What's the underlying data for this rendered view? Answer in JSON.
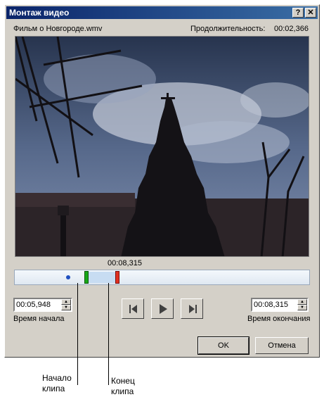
{
  "window": {
    "title": "Монтаж видео",
    "help_label": "?",
    "close_label": "✕"
  },
  "file_name": "Фильм о Новгороде.wmv",
  "duration": {
    "label": "Продолжительность:",
    "value": "00:02,366"
  },
  "timeline": {
    "marker_time": "00:08,315"
  },
  "start": {
    "value": "00:05,948",
    "label": "Время начала"
  },
  "end": {
    "value": "00:08,315",
    "label": "Время окончания"
  },
  "transport": {
    "prev_icon": "step-back-icon",
    "play_icon": "play-icon",
    "next_icon": "step-forward-icon"
  },
  "buttons": {
    "ok": "OK",
    "cancel": "Отмена"
  },
  "callouts": {
    "start_line1": "Начало",
    "start_line2": "клипа",
    "end_line1": "Конец",
    "end_line2": "клипа"
  },
  "colors": {
    "start_marker": "#18a818",
    "end_marker": "#e03020",
    "title_bar": "#0a246a"
  }
}
